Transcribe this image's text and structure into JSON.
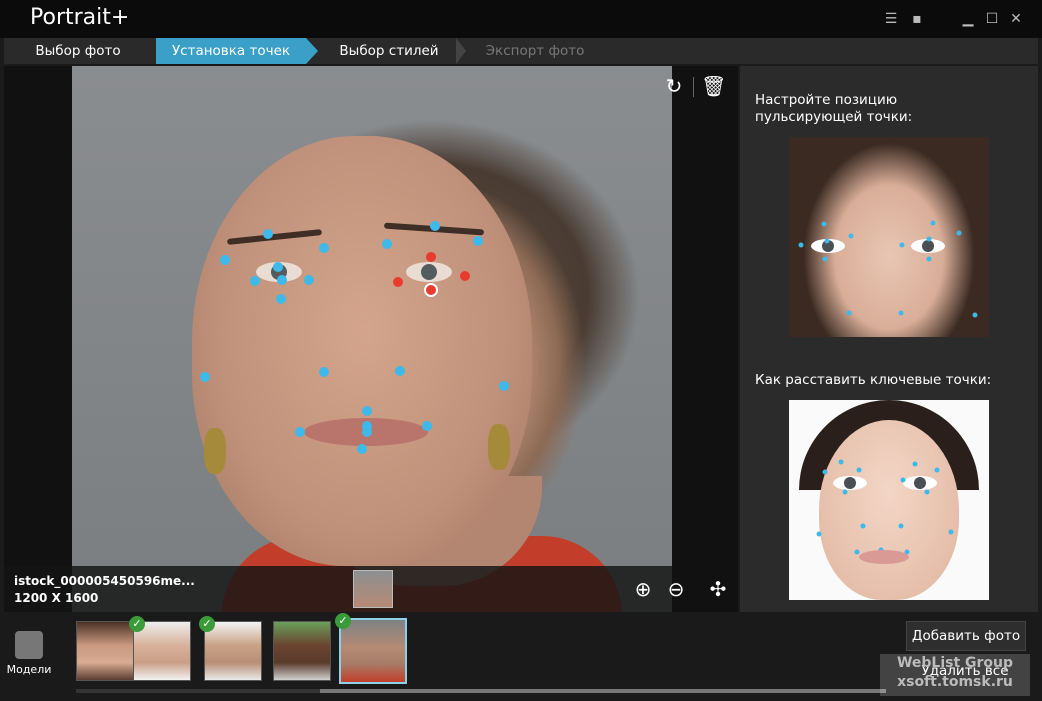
{
  "app": {
    "title": "Portrait+"
  },
  "window_controls": [
    "menu-icon",
    "chat-icon",
    "minimize-icon",
    "maximize-icon",
    "close-icon"
  ],
  "steps": [
    {
      "label": "Выбор фото",
      "state": "done"
    },
    {
      "label": "Установка точек",
      "state": "active"
    },
    {
      "label": "Выбор стилей",
      "state": "normal"
    },
    {
      "label": "Экспорт фото",
      "state": "disabled"
    }
  ],
  "photo": {
    "file_name": "istock_000005450596me...",
    "dimensions": "1200 X 1600"
  },
  "right_panel": {
    "hint_title": "Настройте позицию пульсирующей точки:",
    "guide_title": "Как расставить ключевые точки:"
  },
  "bottom": {
    "models_label": "Модели",
    "add_photo": "Добавить фото",
    "delete_all": "Удалить все",
    "thumbnails": [
      {
        "name": "thumb-1",
        "checked": false
      },
      {
        "name": "thumb-2",
        "checked": true
      },
      {
        "name": "thumb-3",
        "checked": true
      },
      {
        "name": "thumb-4",
        "checked": false
      },
      {
        "name": "thumb-5",
        "checked": true,
        "selected": true
      }
    ]
  },
  "watermark": {
    "line1": "WebList Group",
    "line2": "xsoft.tomsk.ru"
  },
  "colors": {
    "accent": "#3aa0c8",
    "point": "#3db9ea",
    "active_point": "#e83b2e",
    "check": "#3b9b3b"
  }
}
